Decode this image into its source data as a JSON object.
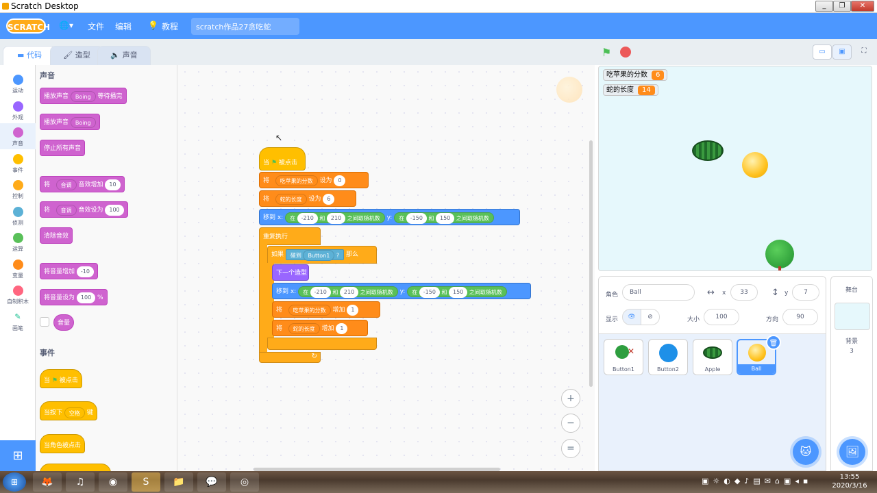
{
  "window": {
    "title": "Scratch Desktop",
    "btn_min": "_",
    "btn_max": "❐",
    "btn_close": "✕"
  },
  "menubar": {
    "logo": "SCRATCH",
    "globe": "🌐▾",
    "file": "文件",
    "edit": "编辑",
    "tutorial_icon": "💡",
    "tutorial": "教程",
    "project_title": "scratch作品27贪吃蛇"
  },
  "tabs": {
    "code": "代码",
    "code_icon": "▬",
    "costume": "造型",
    "costume_icon": "🖌",
    "sound": "声音",
    "sound_icon": "🔈"
  },
  "categories": [
    {
      "label": "运动",
      "color": "#4c97ff"
    },
    {
      "label": "外观",
      "color": "#9966ff"
    },
    {
      "label": "声音",
      "color": "#cf63cf"
    },
    {
      "label": "事件",
      "color": "#ffbf00"
    },
    {
      "label": "控制",
      "color": "#ffab19"
    },
    {
      "label": "侦测",
      "color": "#5cb1d6"
    },
    {
      "label": "运算",
      "color": "#59c059"
    },
    {
      "label": "变量",
      "color": "#ff8c1a"
    },
    {
      "label": "自制积木",
      "color": "#ff6680"
    },
    {
      "label": "画笔",
      "color": "#0fbd8c"
    }
  ],
  "palette": {
    "sound_header": "声音",
    "play_until_done": "播放声音",
    "sound_boing": "Boing",
    "until_done": "等待播完",
    "start_sound": "播放声音",
    "stop_all_sounds": "停止所有声音",
    "change_effect_pre": "将",
    "effect_pitch": "音调",
    "change_effect_mid": "音效增加",
    "change_effect_val": "10",
    "set_effect_pre": "将",
    "set_effect_mid": "音效设为",
    "set_effect_val": "100",
    "clear_effects": "清除音效",
    "change_volume": "将音量增加",
    "change_volume_val": "-10",
    "set_volume": "将音量设为",
    "set_volume_val": "100",
    "percent": "%",
    "volume_reporter": "音量",
    "events_header": "事件",
    "when_flag": "当",
    "when_flag_clicked": "被点击",
    "when_key": "当按下",
    "key_space": "空格",
    "key_suffix": "键",
    "when_sprite_clicked": "当角色被点击"
  },
  "script": {
    "hat_when": "当",
    "hat_clicked": "被点击",
    "set1_pre": "将",
    "var_score": "吃苹果的分数",
    "set1_mid": "设为",
    "set1_val": "0",
    "set2_pre": "将",
    "var_length": "蛇的长度",
    "set2_mid": "设为",
    "set2_val": "6",
    "goto_pre": "移到 x:",
    "rand_pre": "在",
    "x_from": "-210",
    "rand_and": "和",
    "x_to": "210",
    "rand_post": "之间取随机数",
    "goto_y": "y:",
    "y_from": "-150",
    "y_to": "150",
    "forever": "重复执行",
    "if": "如果",
    "touching": "碰到",
    "touch_target": "Button1",
    "q": "?",
    "then": "那么",
    "next_costume": "下一个造型",
    "change_pre": "将",
    "change_mid": "增加",
    "change_val1": "1",
    "change_val2": "1"
  },
  "zoom": {
    "in": "+",
    "out": "−",
    "reset": "="
  },
  "stage_header": {
    "flag": "⚑",
    "small_stage": "▭",
    "normal_stage": "▣",
    "fullscreen": "⛶"
  },
  "monitors": [
    {
      "label": "吃苹果的分数",
      "value": "6"
    },
    {
      "label": "蛇的长度",
      "value": "14"
    }
  ],
  "sprite_info": {
    "sprite_label": "角色",
    "sprite_name": "Ball",
    "x_label": "x",
    "x_val": "33",
    "y_label": "y",
    "y_val": "7",
    "show_label": "显示",
    "size_label": "大小",
    "size_val": "100",
    "dir_label": "方向",
    "dir_val": "90"
  },
  "sprites": [
    {
      "name": "Button1"
    },
    {
      "name": "Button2"
    },
    {
      "name": "Apple"
    },
    {
      "name": "Ball"
    }
  ],
  "stage_pane": {
    "title": "舞台",
    "backdrops_label": "背景",
    "backdrops_count": "3"
  },
  "taskbar": {
    "time": "13:55",
    "date": "2020/3/16"
  }
}
